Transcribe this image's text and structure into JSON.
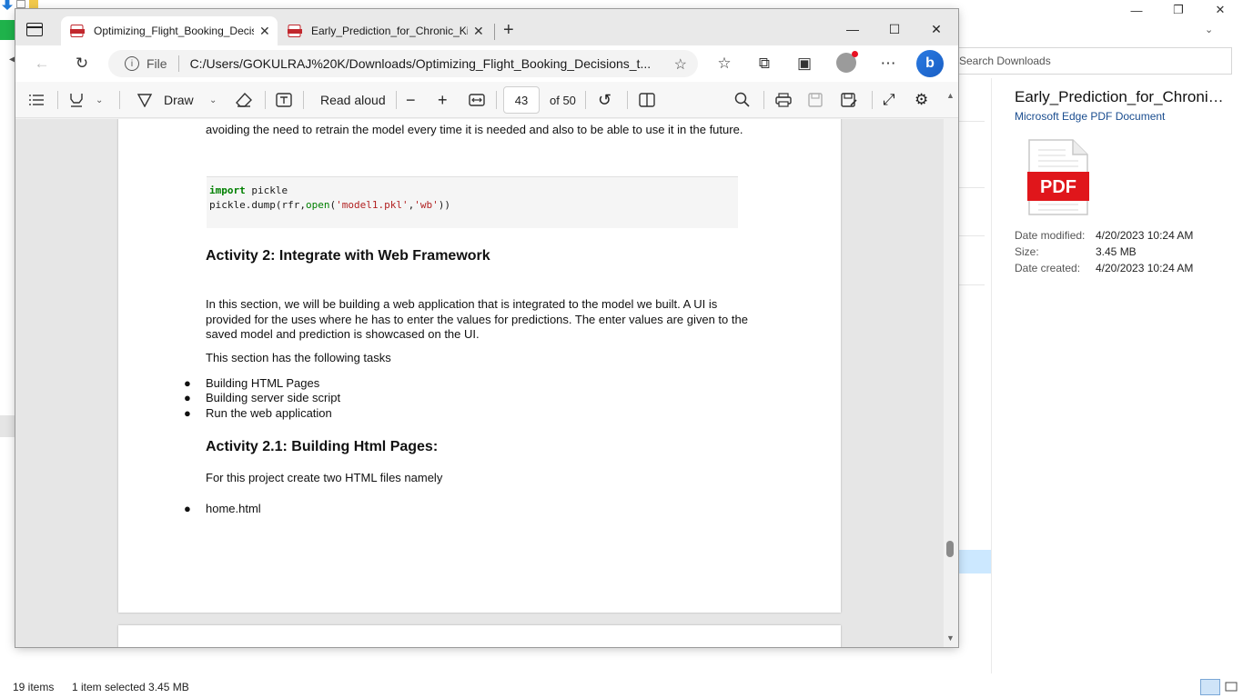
{
  "explorer": {
    "search_placeholder": "Search Downloads",
    "details": {
      "file_name": "Early_Prediction_for_Chronic_K...",
      "file_type": "Microsoft Edge PDF Document",
      "pdf_label": "PDF",
      "props": [
        {
          "key": "Date modified:",
          "value": "4/20/2023 10:24 AM"
        },
        {
          "key": "Size:",
          "value": "3.45 MB"
        },
        {
          "key": "Date created:",
          "value": "4/20/2023 10:24 AM"
        }
      ]
    },
    "status": {
      "items": "19 items",
      "selected": "1 item selected  3.45 MB"
    },
    "window_controls": {
      "minimize": "—",
      "restore": "❐",
      "close": "✕"
    }
  },
  "edge": {
    "tabs": [
      {
        "title": "Optimizing_Flight_Booking_Decisions",
        "active": true
      },
      {
        "title": "Early_Prediction_for_Chronic_Kidney",
        "active": false
      }
    ],
    "window_controls": {
      "minimize": "—",
      "maximize": "☐",
      "close": "✕"
    },
    "address": {
      "scheme": "File",
      "url": "C:/Users/GOKULRAJ%20K/Downloads/Optimizing_Flight_Booking_Decisions_t..."
    },
    "pdf_toolbar": {
      "draw_label": "Draw",
      "read_aloud_label": "Read aloud",
      "page_current": "43",
      "page_total": "of 50"
    }
  },
  "document": {
    "intro_line": "avoiding the need to retrain the model every time it is needed and also to be able to use it in the future.",
    "code_line1_kw": "import",
    "code_line1_rest": " pickle",
    "code_line2_a": "pickle.dump(rfr,",
    "code_line2_open": "open",
    "code_line2_b": "(",
    "code_line2_s1": "'model1.pkl'",
    "code_line2_c": ",",
    "code_line2_s2": "'wb'",
    "code_line2_d": "))",
    "heading1": "Activity 2: Integrate with Web Framework",
    "para1_l1": "In this section, we will be building a web application that is integrated to the model we built. A UI is",
    "para1_l2": "provided for the uses where he has to enter the values for predictions. The enter values are given to the",
    "para1_l3": "saved model and prediction is showcased on the UI.",
    "para2": "This section has the following tasks",
    "tasks": [
      "Building HTML Pages",
      "Building server side script",
      "Run the web application"
    ],
    "heading2": "Activity 2.1: Building Html Pages:",
    "para3": "For this project create two HTML files namely",
    "files": [
      "home.html"
    ]
  }
}
